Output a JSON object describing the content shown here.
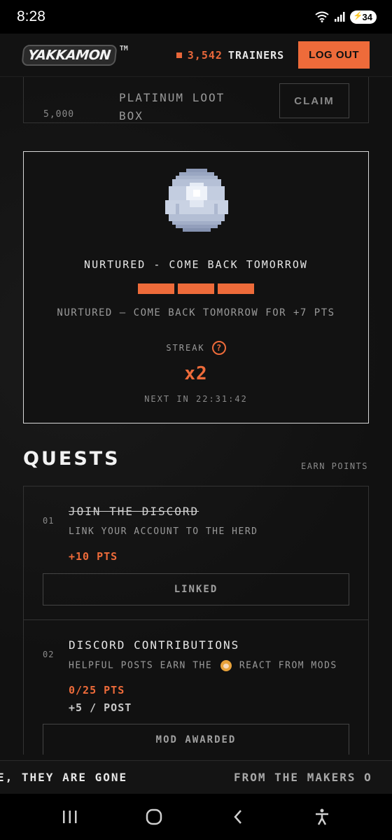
{
  "status_bar": {
    "time": "8:28",
    "battery": "34"
  },
  "header": {
    "logo_text": "YAKKAMON",
    "logo_tm": "TM",
    "trainer_count": "3,542",
    "trainer_label": "TRAINERS",
    "logout_label": "LOG OUT"
  },
  "reward": {
    "points": "5,000",
    "name_line1": "PLATINUM LOOT",
    "name_line2": "BOX",
    "claim_label": "CLAIM"
  },
  "egg": {
    "title": "NURTURED - COME BACK TOMORROW",
    "progress_segments": 3,
    "subtitle": "NURTURED — COME BACK TOMORROW FOR +7 PTS",
    "streak_label": "STREAK",
    "streak_help": "?",
    "streak_value": "x2",
    "next_in": "NEXT IN 22:31:42"
  },
  "quests": {
    "title": "QUESTS",
    "earn_points": "EARN POINTS",
    "items": [
      {
        "num": "01",
        "title": "JOIN THE DISCORD",
        "desc": "LINK YOUR ACCOUNT TO THE HERD",
        "pts": "+10 PTS",
        "button": "LINKED"
      },
      {
        "num": "02",
        "title": "DISCORD CONTRIBUTIONS",
        "desc_before": "HELPFUL POSTS EARN THE",
        "desc_after": "REACT FROM MODS",
        "pts": "0/25 PTS",
        "rate": "+5 / POST",
        "button": "MOD AWARDED"
      }
    ]
  },
  "ticker": {
    "text1": "E, THEY ARE GONE",
    "text2": "FROM THE MAKERS O"
  },
  "colors": {
    "accent": "#ee6b3a",
    "background": "#111111",
    "text": "#e6e6e6"
  }
}
